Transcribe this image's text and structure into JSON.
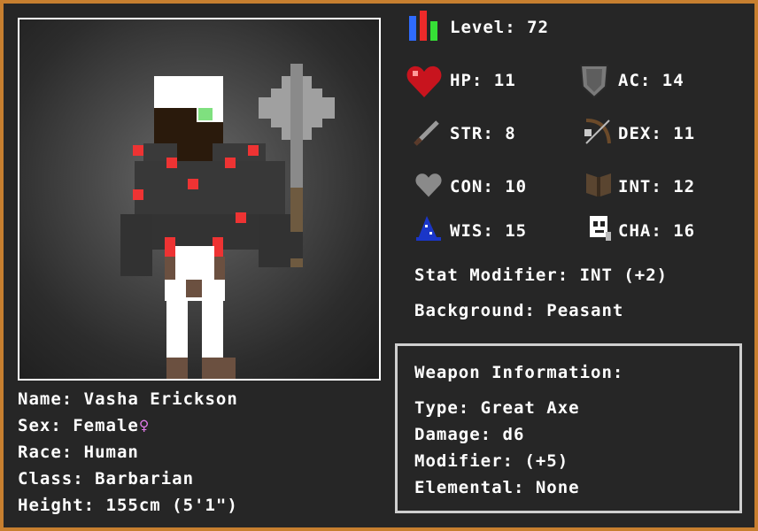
{
  "character": {
    "name_label": "Name:",
    "name": "Vasha Erickson",
    "sex_label": "Sex:",
    "sex": "Female",
    "sex_symbol": "♀",
    "race_label": "Race:",
    "race": "Human",
    "class_label": "Class:",
    "class": "Barbarian",
    "height_label": "Height:",
    "height": "155cm (5'1\")"
  },
  "stats": {
    "level": {
      "label": "Level:",
      "value": "72",
      "icon": "level-bars-icon"
    },
    "hp": {
      "label": "HP:",
      "value": "11",
      "icon": "heart-icon"
    },
    "ac": {
      "label": "AC:",
      "value": "14",
      "icon": "shield-icon"
    },
    "str": {
      "label": "STR:",
      "value": "8",
      "icon": "sword-icon"
    },
    "dex": {
      "label": "DEX:",
      "value": "11",
      "icon": "bow-icon"
    },
    "con": {
      "label": "CON:",
      "value": "10",
      "icon": "grey-heart-icon"
    },
    "int": {
      "label": "INT:",
      "value": "12",
      "icon": "book-icon"
    },
    "wis": {
      "label": "WIS:",
      "value": "15",
      "icon": "wizard-hat-icon"
    },
    "cha": {
      "label": "CHA:",
      "value": "16",
      "icon": "mask-icon"
    },
    "modifier_label": "Stat Modifier:",
    "modifier": "INT (+2)",
    "background_label": "Background:",
    "background": "Peasant"
  },
  "weapon": {
    "title": "Weapon Information:",
    "type_label": "Type:",
    "type": "Great Axe",
    "damage_label": "Damage:",
    "damage": "d6",
    "modifier_label": "Modifier:",
    "modifier": "(+5)",
    "elemental_label": "Elemental:",
    "elemental": "None"
  },
  "colors": {
    "frame": "#c77f2f",
    "panel": "#262626",
    "text": "#ffffff",
    "accent_red": "#ee3333",
    "female": "#e07ae8"
  }
}
